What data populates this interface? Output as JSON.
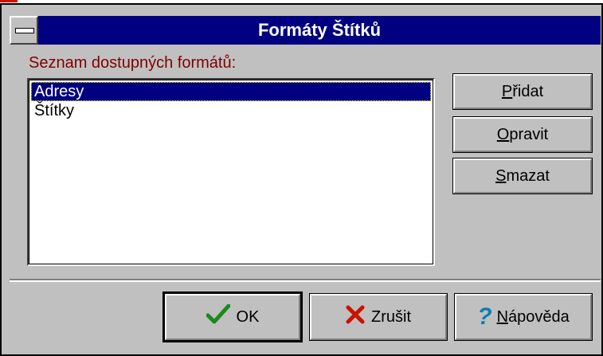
{
  "dialog": {
    "title": "Formáty Štítků",
    "list_label": "Seznam dostupných formátů:",
    "list_items": [
      "Adresy",
      "Štítky"
    ],
    "selected_index": 0
  },
  "side_buttons": {
    "add": {
      "prefix": "",
      "accel": "P",
      "rest": "řidat"
    },
    "edit": {
      "prefix": "",
      "accel": "O",
      "rest": "pravit"
    },
    "delete": {
      "prefix": "",
      "accel": "S",
      "rest": "mazat"
    }
  },
  "bottom_buttons": {
    "ok": {
      "label": "OK",
      "icon": "checkmark-icon"
    },
    "cancel": {
      "label": "Zrušit",
      "icon": "x-icon"
    },
    "help": {
      "accel": "N",
      "rest": "ápověda",
      "icon": "question-icon"
    }
  },
  "colors": {
    "titlebar": "#000080",
    "label_text": "#800000",
    "checkmark": "#1a8a1a",
    "x_mark": "#cc1100",
    "question": "#0a7fb0"
  }
}
